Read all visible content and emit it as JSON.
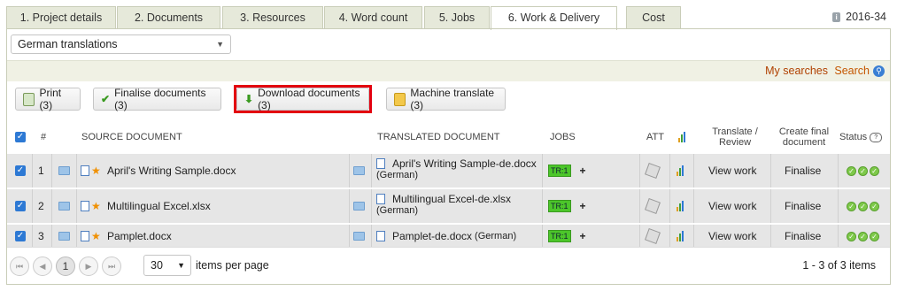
{
  "tabs": [
    {
      "label": "1. Project details"
    },
    {
      "label": "2. Documents"
    },
    {
      "label": "3. Resources"
    },
    {
      "label": "4. Word count"
    },
    {
      "label": "5. Jobs"
    },
    {
      "label": "6. Work & Delivery"
    },
    {
      "label": "Cost"
    }
  ],
  "active_tab": "6. Work & Delivery",
  "project_ref": "2016-34",
  "language_select": {
    "value": "German translations"
  },
  "search_bar": {
    "my_searches": "My searches",
    "search": "Search"
  },
  "toolbar": {
    "print": "Print (3)",
    "finalise": "Finalise documents (3)",
    "download": "Download documents (3)",
    "machine": "Machine translate (3)"
  },
  "table": {
    "headers": {
      "num": "#",
      "source": "SOURCE DOCUMENT",
      "translated": "TRANSLATED DOCUMENT",
      "jobs": "JOBS",
      "att": "ATT",
      "translate_review": "Translate / Review",
      "create_final": "Create final document",
      "status": "Status"
    },
    "rows": [
      {
        "num": "1",
        "source": "April's Writing Sample.docx",
        "translated": "April's Writing Sample-de.docx",
        "lang": "(German)",
        "job": "TR:1",
        "add": "+",
        "view": "View work",
        "finalise": "Finalise"
      },
      {
        "num": "2",
        "source": "Multilingual Excel.xlsx",
        "translated": "Multilingual Excel-de.xlsx",
        "lang": "(German)",
        "job": "TR:1",
        "add": "+",
        "view": "View work",
        "finalise": "Finalise"
      },
      {
        "num": "3",
        "source": "Pamplet.docx",
        "translated": "Pamplet-de.docx",
        "lang": "(German)",
        "job": "TR:1",
        "add": "+",
        "view": "View work",
        "finalise": "Finalise"
      }
    ]
  },
  "pager": {
    "current": "1",
    "page_size": "30",
    "per_page_label": "items per page",
    "summary": "1 - 3 of 3 items"
  },
  "colors": {
    "highlight": "#e3000f",
    "tab_bg": "#e6e9da",
    "link": "#c45500",
    "job_badge": "#4cc62a"
  }
}
